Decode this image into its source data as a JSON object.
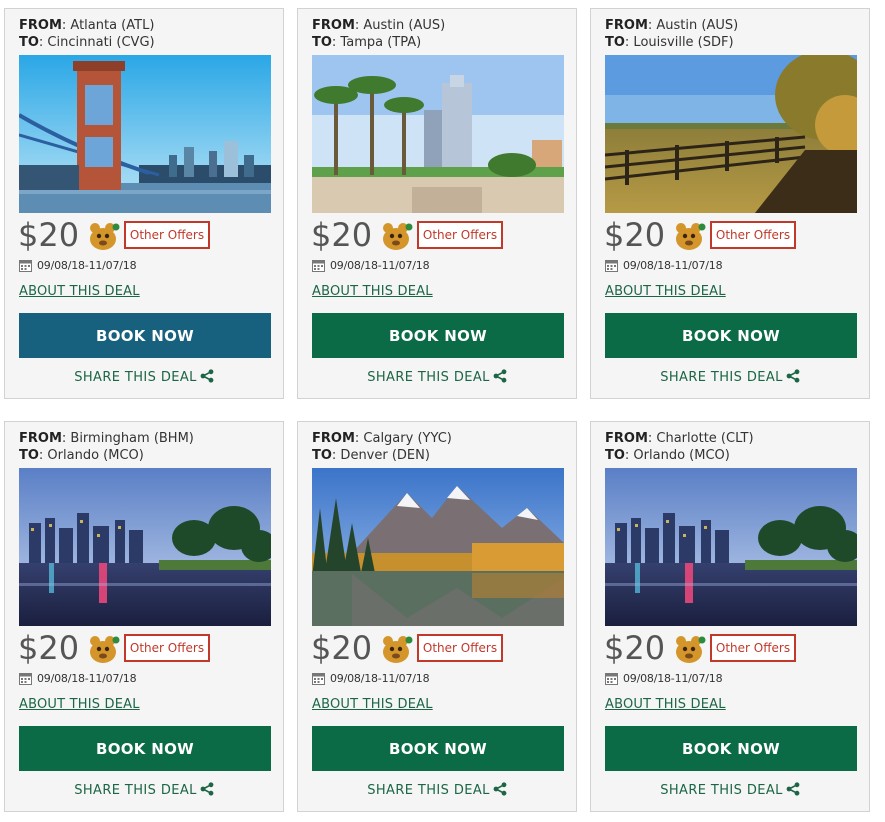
{
  "deals": [
    {
      "from_label": "FROM",
      "from_value": ": Atlanta (ATL)",
      "to_label": "TO",
      "to_value": ": Cincinnati (CVG)",
      "image": "cincinnati-bridge-skyline",
      "price": "$20",
      "other_offers": "Other Offers",
      "dates": "09/08/18-11/07/18",
      "about": "ABOUT THIS DEAL",
      "book": "BOOK NOW",
      "share": "SHARE THIS DEAL"
    },
    {
      "from_label": "FROM",
      "from_value": ": Austin (AUS)",
      "to_label": "TO",
      "to_value": ": Tampa (TPA)",
      "image": "tampa-palms-tower",
      "price": "$20",
      "other_offers": "Other Offers",
      "dates": "09/08/18-11/07/18",
      "about": "ABOUT THIS DEAL",
      "book": "BOOK NOW",
      "share": "SHARE THIS DEAL"
    },
    {
      "from_label": "FROM",
      "from_value": ": Austin (AUS)",
      "to_label": "TO",
      "to_value": ": Louisville (SDF)",
      "image": "louisville-farm-fence",
      "price": "$20",
      "other_offers": "Other Offers",
      "dates": "09/08/18-11/07/18",
      "about": "ABOUT THIS DEAL",
      "book": "BOOK NOW",
      "share": "SHARE THIS DEAL"
    },
    {
      "from_label": "FROM",
      "from_value": ": Birmingham (BHM)",
      "to_label": "TO",
      "to_value": ": Orlando (MCO)",
      "image": "orlando-lake-skyline",
      "price": "$20",
      "other_offers": "Other Offers",
      "dates": "09/08/18-11/07/18",
      "about": "ABOUT THIS DEAL",
      "book": "BOOK NOW",
      "share": "SHARE THIS DEAL"
    },
    {
      "from_label": "FROM",
      "from_value": ": Calgary (YYC)",
      "to_label": "TO",
      "to_value": ": Denver (DEN)",
      "image": "denver-mountain-lake",
      "price": "$20",
      "other_offers": "Other Offers",
      "dates": "09/08/18-11/07/18",
      "about": "ABOUT THIS DEAL",
      "book": "BOOK NOW",
      "share": "SHARE THIS DEAL"
    },
    {
      "from_label": "FROM",
      "from_value": ": Charlotte (CLT)",
      "to_label": "TO",
      "to_value": ": Orlando (MCO)",
      "image": "orlando-lake-skyline",
      "price": "$20",
      "other_offers": "Other Offers",
      "dates": "09/08/18-11/07/18",
      "about": "ABOUT THIS DEAL",
      "book": "BOOK NOW",
      "share": "SHARE THIS DEAL"
    }
  ],
  "icons": {
    "mascot": "frontier-mascot-icon",
    "calendar": "calendar-icon",
    "share": "share-icon"
  },
  "colors": {
    "book_primary": "#0b6b46",
    "book_hover": "#17607e",
    "link": "#1c6646",
    "offers_border": "#c0392b",
    "card_bg": "#f5f5f5"
  }
}
